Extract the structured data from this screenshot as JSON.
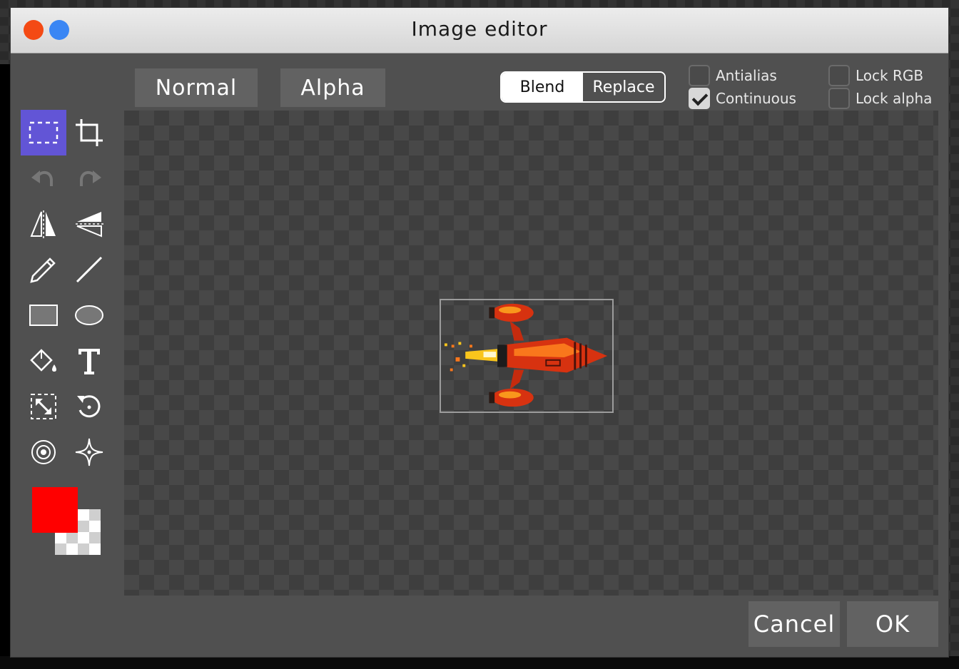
{
  "window": {
    "title": "Image editor"
  },
  "modes": {
    "normal": "Normal",
    "alpha": "Alpha"
  },
  "blend_mode": {
    "options": [
      "Blend",
      "Replace"
    ],
    "selected": "Blend"
  },
  "options": {
    "antialias": {
      "label": "Antialias",
      "checked": false
    },
    "continuous": {
      "label": "Continuous",
      "checked": true
    },
    "lock_rgb": {
      "label": "Lock RGB",
      "checked": false
    },
    "lock_alpha": {
      "label": "Lock alpha",
      "checked": false
    }
  },
  "tools": [
    "select-rect-icon",
    "crop-icon",
    "undo-icon",
    "redo-icon",
    "flip-horizontal-icon",
    "flip-vertical-icon",
    "pencil-icon",
    "line-icon",
    "rectangle-icon",
    "ellipse-icon",
    "fill-bucket-icon",
    "text-icon",
    "resize-icon",
    "rotate-icon",
    "target-icon",
    "sparkle-icon"
  ],
  "colors": {
    "foreground": "#ff0000",
    "background": "transparent",
    "accent": "#6255d6"
  },
  "buttons": {
    "cancel": "Cancel",
    "ok": "OK"
  }
}
